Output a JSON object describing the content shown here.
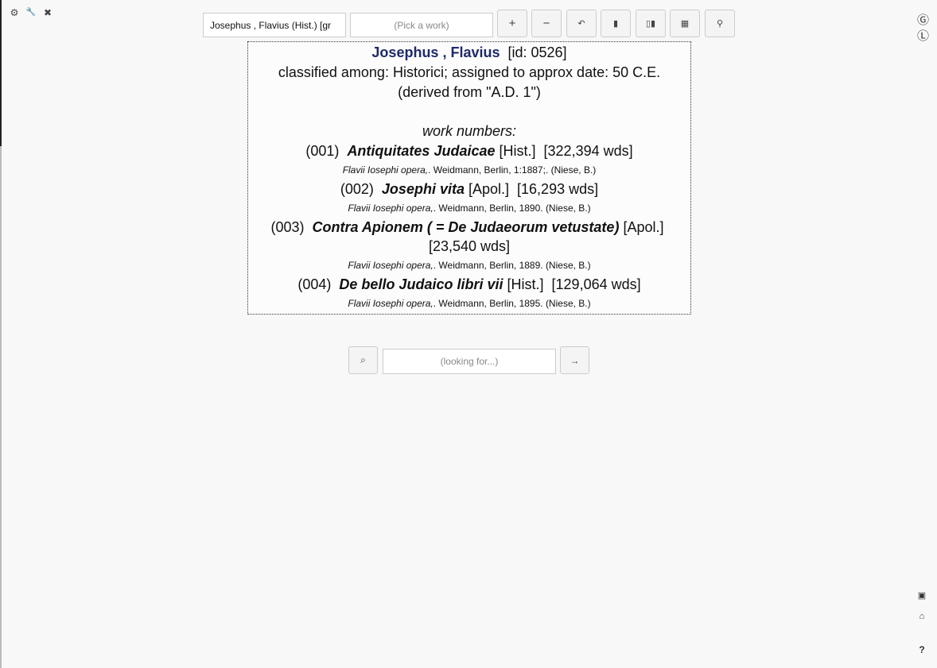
{
  "corner_tools": {
    "settings_icon": "⚙",
    "wrench_icon": "🔧",
    "close_icon": "✖"
  },
  "right_top": {
    "g_icon": "Ⓖ",
    "l_icon": "Ⓛ"
  },
  "right_bottom": {
    "save_icon": "▣",
    "open_icon": "⌂",
    "help_label": "?"
  },
  "toolbar": {
    "author_value": "Josephus , Flavius (Hist.) [gr",
    "work_placeholder": "(Pick a work)",
    "buttons": {
      "plus": "+",
      "minus": "−",
      "undo": "↶",
      "book": "▮",
      "books": "▯▮",
      "table": "▦",
      "stamp": "⚲"
    }
  },
  "author": {
    "name": "Josephus , Flavius",
    "id_text": "[id: 0526]",
    "classification": "classified among: Historici; assigned to approx date: 50 C.E. (derived from \"A.D. 1\")",
    "work_numbers_label": "work numbers:",
    "works": [
      {
        "number": "(001)",
        "title": "Antiquitates Judaicae",
        "genre": "[Hist.]",
        "words": "[322,394 wds]",
        "edition_title": "Flavii Iosephi opera,",
        "edition_rest": ". Weidmann, Berlin, 1:1887;. (Niese, B.)"
      },
      {
        "number": "(002)",
        "title": "Josephi vita",
        "genre": "[Apol.]",
        "words": "[16,293 wds]",
        "edition_title": "Flavii Iosephi opera,",
        "edition_rest": ". Weidmann, Berlin, 1890. (Niese, B.)"
      },
      {
        "number": "(003)",
        "title": "Contra Apionem ( = De Judaeorum vetustate)",
        "genre": "[Apol.]",
        "words": "[23,540 wds]",
        "edition_title": "Flavii Iosephi opera,",
        "edition_rest": ". Weidmann, Berlin, 1889. (Niese, B.)"
      },
      {
        "number": "(004)",
        "title": "De bello Judaico libri vii",
        "genre": "[Hist.]",
        "words": "[129,064 wds]",
        "edition_title": "Flavii Iosephi opera,",
        "edition_rest": ". Weidmann, Berlin, 1895. (Niese, B.)"
      }
    ]
  },
  "search": {
    "search_icon": "⌕",
    "placeholder": "(looking for...)",
    "go_icon": "→"
  }
}
